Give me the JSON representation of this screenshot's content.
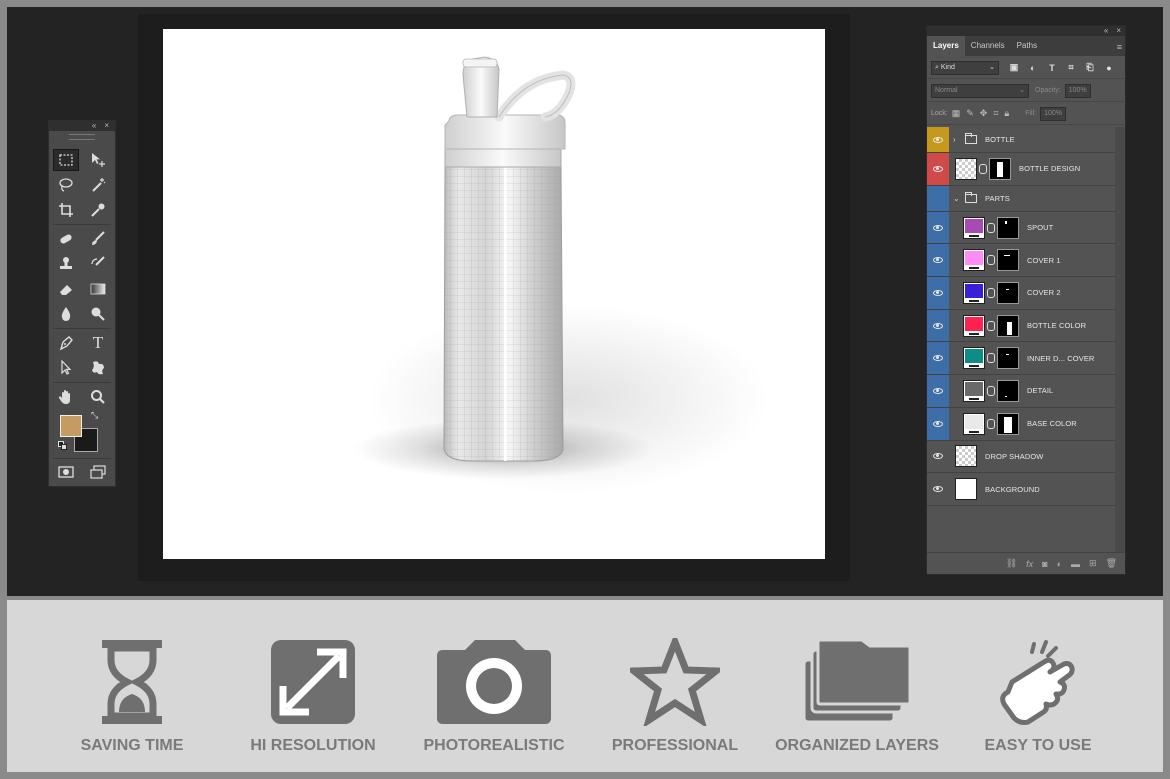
{
  "tools_panel": {
    "header_controls": [
      "«",
      "×"
    ],
    "tools": [
      "rectangular-marquee",
      "move",
      "lasso",
      "magic-wand",
      "crop",
      "eyedropper",
      "healing-brush",
      "brush",
      "clone-stamp",
      "history-brush",
      "eraser",
      "gradient",
      "blur",
      "dodge",
      "pen",
      "type",
      "path-selection",
      "custom-shape",
      "hand",
      "zoom",
      "quick-mask",
      "screen-mode"
    ],
    "type_tool_label": "T",
    "foreground_color": "#c59a63",
    "background_color": "#1a1a1a"
  },
  "layers_panel": {
    "header_controls": [
      "«",
      "×"
    ],
    "tabs": [
      "Layers",
      "Channels",
      "Paths"
    ],
    "filter_kind": "Kind",
    "blend_mode": "Normal",
    "opacity_label": "Opacity:",
    "opacity_value": "100%",
    "lock_label": "Lock:",
    "fill_label": "Fill:",
    "fill_value": "100%",
    "layers": [
      {
        "name": "BOTTLE",
        "kind": "group",
        "expanded": false,
        "vis_color": "#c59a1c"
      },
      {
        "name": "BOTTLE DESIGN",
        "kind": "smart",
        "vis_color": "#d14a4a"
      },
      {
        "name": "PARTS",
        "kind": "group",
        "expanded": true,
        "vis_color": "#3d6ea8",
        "hidden": true
      },
      {
        "name": "SPOUT",
        "kind": "color",
        "fill": "#a84ab4",
        "vis_color": "#3d6ea8"
      },
      {
        "name": "COVER 1",
        "kind": "color",
        "fill": "#ff8cf4",
        "vis_color": "#3d6ea8"
      },
      {
        "name": "COVER 2",
        "kind": "color",
        "fill": "#3a1fd8",
        "vis_color": "#3d6ea8"
      },
      {
        "name": "BOTTLE COLOR",
        "kind": "color",
        "fill": "#ff2250",
        "vis_color": "#3d6ea8"
      },
      {
        "name": "INNER D... COVER",
        "kind": "color",
        "fill": "#0e8c86",
        "vis_color": "#3d6ea8"
      },
      {
        "name": "DETAIL",
        "kind": "color",
        "fill": "#6a6a6a",
        "vis_color": "#3d6ea8"
      },
      {
        "name": "BASE COLOR",
        "kind": "color",
        "fill": "#e9e9e9",
        "vis_color": "#3d6ea8"
      },
      {
        "name": "DROP SHADOW",
        "kind": "pixel",
        "vis_color": "#535353"
      },
      {
        "name": "BACKGROUND",
        "kind": "background",
        "vis_color": "#535353"
      }
    ],
    "footer_icons": [
      "link-icon",
      "fx-icon",
      "mask-icon",
      "adjustment-icon",
      "folder-icon",
      "new-layer-icon",
      "trash-icon"
    ],
    "footer_fx": "fx"
  },
  "features": [
    {
      "label": "SAVING TIME",
      "icon": "hourglass-icon"
    },
    {
      "label": "HI RESOLUTION",
      "icon": "expand-icon"
    },
    {
      "label": "PHOTOREALISTIC",
      "icon": "camera-icon"
    },
    {
      "label": "PROFESSIONAL",
      "icon": "star-icon"
    },
    {
      "label": "ORGANIZED LAYERS",
      "icon": "layers-folder-icon"
    },
    {
      "label": "EASY TO USE",
      "icon": "hand-tap-icon"
    }
  ]
}
